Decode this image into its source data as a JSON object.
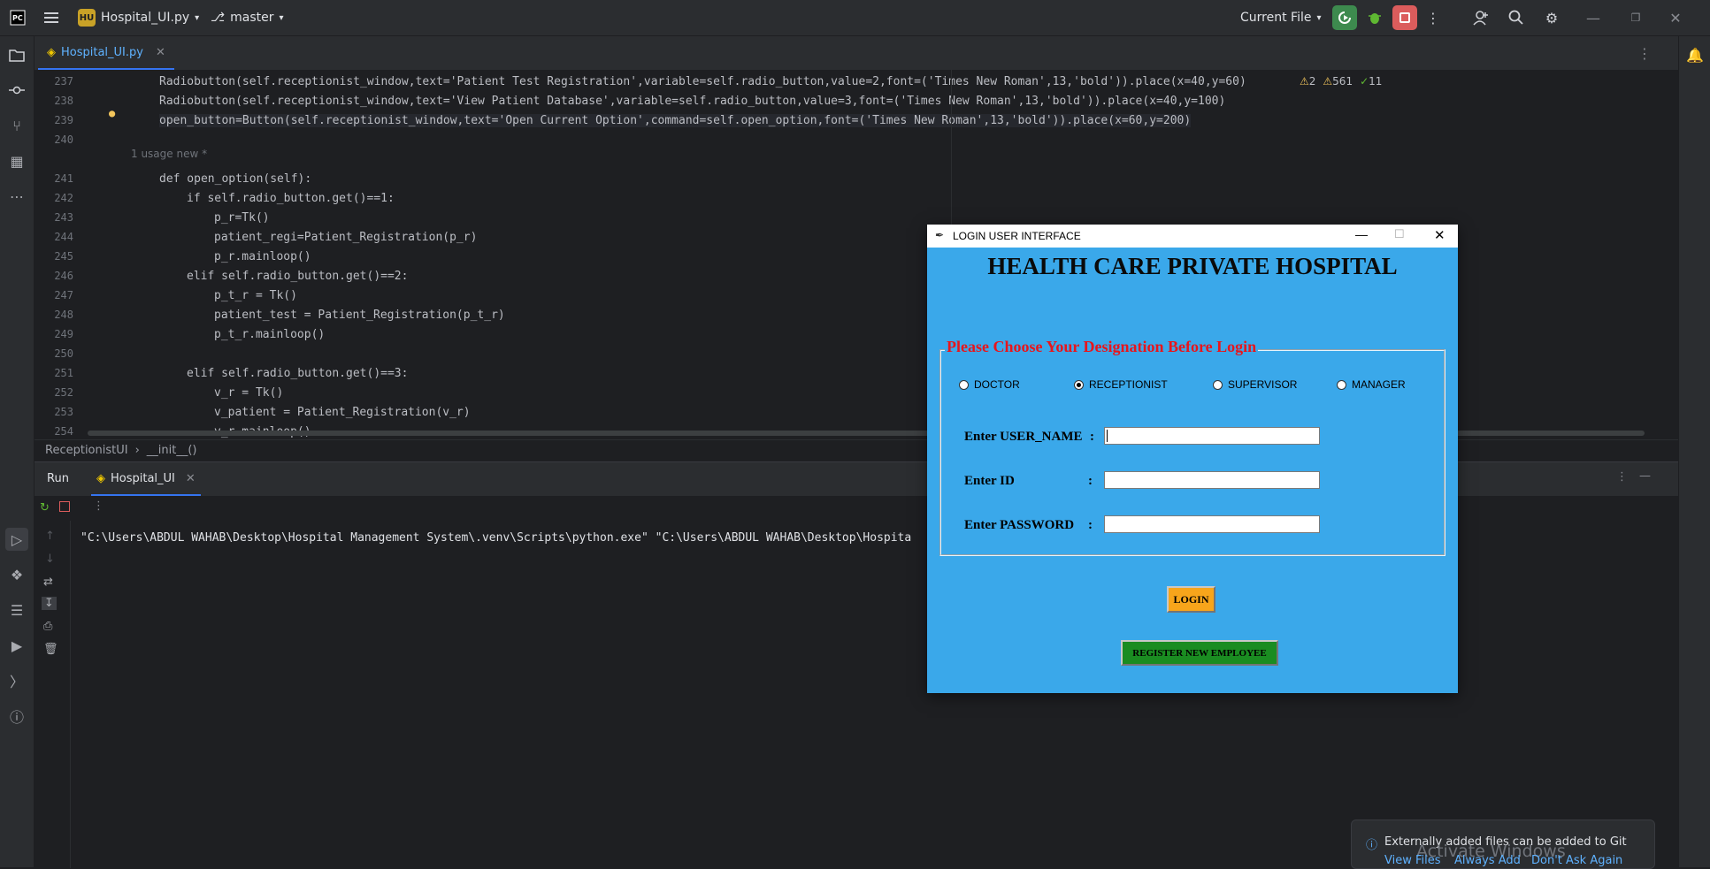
{
  "titlebar": {
    "project_badge": "HU",
    "project_name": "Hospital_UI.py",
    "branch": "master",
    "run_config": "Current File",
    "icons": [
      "logo-icon",
      "hamburger-menu-icon",
      "branch-icon",
      "run-icon",
      "debug-icon",
      "stop-icon",
      "more-icon",
      "add-user-icon",
      "search-icon",
      "settings-icon",
      "minimize-icon",
      "restore-icon",
      "close-icon"
    ]
  },
  "editor_tab": {
    "label": "Hospital_UI.py"
  },
  "inspections": {
    "warnings": "2",
    "weak_warnings": "561",
    "ok": "11"
  },
  "editor": {
    "lines": [
      {
        "n": "237",
        "code": "Radiobutton(self.receptionist_window,text='Patient Test Registration',variable=self.radio_button,value=2,font=('Times New Roman',13,'bold')).place(x=40,y=60)"
      },
      {
        "n": "238",
        "code": "Radiobutton(self.receptionist_window,text='View Patient Database',variable=self.radio_button,value=3,font=('Times New Roman',13,'bold')).place(x=40,y=100)"
      },
      {
        "n": "239",
        "code": "open_button=Button(self.receptionist_window,text='Open Current Option',command=self.open_option,font=('Times New Roman',13,'bold')).place(x=60,y=200)"
      },
      {
        "n": "240",
        "code": ""
      },
      {
        "n": "241",
        "code": "def open_option(self):"
      },
      {
        "n": "242",
        "code": "if self.radio_button.get()==1:"
      },
      {
        "n": "243",
        "code": "p_r=Tk()"
      },
      {
        "n": "244",
        "code": "patient_regi=Patient_Registration(p_r)"
      },
      {
        "n": "245",
        "code": "p_r.mainloop()"
      },
      {
        "n": "246",
        "code": "elif self.radio_button.get()==2:"
      },
      {
        "n": "247",
        "code": "p_t_r = Tk()"
      },
      {
        "n": "248",
        "code": "patient_test = Patient_Registration(p_t_r)"
      },
      {
        "n": "249",
        "code": "p_t_r.mainloop()"
      },
      {
        "n": "250",
        "code": ""
      },
      {
        "n": "251",
        "code": "elif self.radio_button.get()==3:"
      },
      {
        "n": "252",
        "code": "v_r = Tk()"
      },
      {
        "n": "253",
        "code": "v_patient = Patient_Registration(v_r)"
      },
      {
        "n": "254",
        "code": "v_r.mainloop()"
      }
    ],
    "usage_hint": "1 usage   new *"
  },
  "breadcrumbs": {
    "class": "ReceptionistUI",
    "method": "__init__()"
  },
  "run_panel": {
    "title": "Run",
    "tab": "Hospital_UI",
    "console_line": "\"C:\\Users\\ABDUL WAHAB\\Desktop\\Hospital Management System\\.venv\\Scripts\\python.exe\" \"C:\\Users\\ABDUL WAHAB\\Desktop\\Hospita"
  },
  "notification": {
    "message": "Externally added files can be added to Git",
    "actions": [
      "View Files",
      "Always Add",
      "Don't Ask Again"
    ],
    "watermark": "Activate Windows"
  },
  "login_window": {
    "title": "LOGIN USER INTERFACE",
    "heading": "HEALTH CARE PRIVATE HOSPITAL",
    "legend": "Please Choose Your Designation Before Login",
    "designations": [
      {
        "label": "DOCTOR",
        "selected": false
      },
      {
        "label": "RECEPTIONIST",
        "selected": true
      },
      {
        "label": "SUPERVISOR",
        "selected": false
      },
      {
        "label": "MANAGER",
        "selected": false
      }
    ],
    "fields": [
      {
        "label": "Enter USER_NAME",
        "colon": ":",
        "value": ""
      },
      {
        "label": "Enter ID",
        "colon": ":",
        "value": ""
      },
      {
        "label": "Enter PASSWORD",
        "colon": ":",
        "value": ""
      }
    ],
    "login_button": "LOGIN",
    "register_button": "REGISTER NEW EMPLOYEE",
    "colors": {
      "background": "#3aa8ea",
      "legend": "#e8151b",
      "login": "#f7a51b",
      "register": "#1a8c21"
    }
  }
}
